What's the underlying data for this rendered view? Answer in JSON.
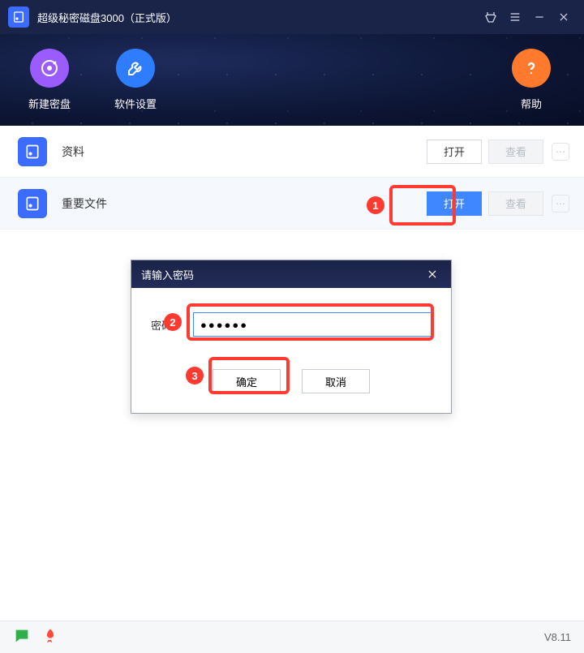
{
  "titlebar": {
    "app_title": "超级秘密磁盘3000（正式版）"
  },
  "toolbar": {
    "new_disk_label": "新建密盘",
    "settings_label": "软件设置",
    "help_label": "帮助"
  },
  "rows": [
    {
      "name": "资料",
      "open_label": "打开",
      "view_label": "查看"
    },
    {
      "name": "重要文件",
      "open_label": "打开",
      "view_label": "查看"
    }
  ],
  "dialog": {
    "title": "请输入密码",
    "pw_label": "密码:",
    "pw_value": "●●●●●●",
    "ok_label": "确定",
    "cancel_label": "取消"
  },
  "annotations": {
    "marker1": "1",
    "marker2": "2",
    "marker3": "3"
  },
  "footer": {
    "version": "V8.11"
  }
}
